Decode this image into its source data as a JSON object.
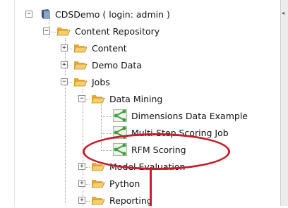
{
  "tree": {
    "root": {
      "label": "CDSDemo ( login: admin )"
    },
    "repository": {
      "label": "Content Repository"
    },
    "content": {
      "label": "Content"
    },
    "demo_data": {
      "label": "Demo Data"
    },
    "jobs": {
      "label": "Jobs"
    },
    "data_mining": {
      "label": "Data Mining"
    },
    "job_dimensions": {
      "label": "Dimensions Data Example"
    },
    "job_multistep": {
      "label": "Multi-Step Scoring Job"
    },
    "job_rfm": {
      "label": "RFM Scoring"
    },
    "model_evaluation": {
      "label": "Model Evaluation"
    },
    "python": {
      "label": "Python"
    },
    "reporting": {
      "label": "Reporting"
    }
  },
  "colors": {
    "annotation": "#c41e2b",
    "folder": "#f3c25a",
    "job_icon": "#3f9e3f"
  }
}
